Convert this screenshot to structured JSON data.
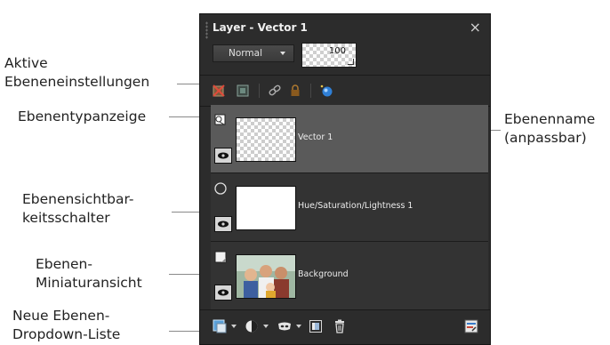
{
  "panel": {
    "title": "Layer - Vector 1",
    "close_glyph": "×",
    "blend_mode": "Normal",
    "opacity": "100"
  },
  "layers": [
    {
      "name": "Vector 1",
      "type_icon": "vector-layer-icon",
      "selected": true
    },
    {
      "name": "Hue/Saturation/Lightness 1",
      "type_icon": "adjustment-layer-icon",
      "selected": false
    },
    {
      "name": "Background",
      "type_icon": "raster-layer-icon",
      "selected": false
    }
  ],
  "callouts": {
    "active_settings": [
      "Aktive",
      "Ebeneneinstellungen"
    ],
    "type_indicator": [
      "Ebenentypanzeige"
    ],
    "layer_name": [
      "Ebenenname",
      "(anpassbar)"
    ],
    "visibility_toggle": [
      "Ebenensichtbar-",
      "keitsschalter"
    ],
    "thumbnail": [
      "Ebenen-",
      "Miniaturansicht"
    ],
    "new_layer_dropdown": [
      "Neue Ebenen-",
      "Dropdown-Liste"
    ]
  },
  "colors": {
    "panel_bg": "#2c2c2c",
    "selected_layer_bg": "#5a5a5a",
    "layer_bg": "#333333",
    "arrow": "#8a8a8a"
  }
}
